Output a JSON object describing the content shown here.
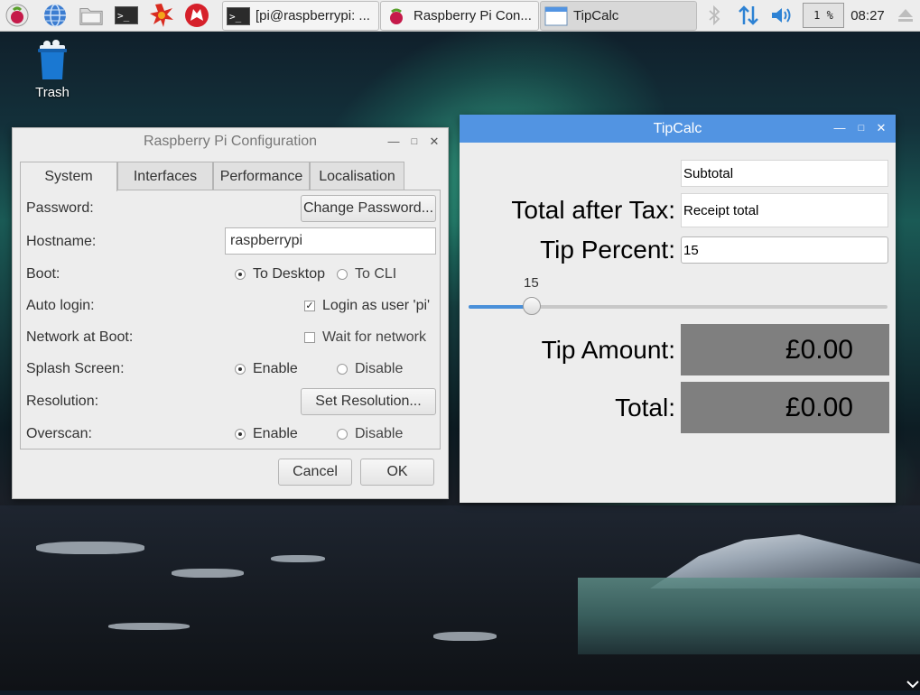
{
  "taskbar": {
    "tasks": [
      {
        "label": "[pi@raspberrypi: ..."
      },
      {
        "label": "Raspberry Pi Con..."
      },
      {
        "label": "TipCalc"
      }
    ],
    "cpu": "1 %",
    "clock": "08:27"
  },
  "desktop": {
    "trash_label": "Trash"
  },
  "raspi_config": {
    "title": "Raspberry Pi Configuration",
    "tabs": [
      "System",
      "Interfaces",
      "Performance",
      "Localisation"
    ],
    "password_label": "Password:",
    "change_password": "Change Password...",
    "hostname_label": "Hostname:",
    "hostname_value": "raspberrypi",
    "boot_label": "Boot:",
    "boot_desktop": "To Desktop",
    "boot_cli": "To CLI",
    "autologin_label": "Auto login:",
    "autologin_option": "Login as user 'pi'",
    "network_label": "Network at Boot:",
    "network_option": "Wait for network",
    "splash_label": "Splash Screen:",
    "splash_enable": "Enable",
    "splash_disable": "Disable",
    "resolution_label": "Resolution:",
    "set_resolution": "Set Resolution...",
    "overscan_label": "Overscan:",
    "overscan_enable": "Enable",
    "overscan_disable": "Disable",
    "cancel": "Cancel",
    "ok": "OK"
  },
  "tipcalc": {
    "title": "TipCalc",
    "subtotal_placeholder": "Subtotal",
    "total_after_tax_label": "Total after Tax:",
    "receipt_placeholder": "Receipt total",
    "tip_percent_label": "Tip Percent:",
    "tip_percent_value": "15",
    "slider_value": "15",
    "slider_fraction": 0.15,
    "tip_amount_label": "Tip Amount:",
    "tip_amount_value": "£0.00",
    "total_label": "Total:",
    "total_value": "£0.00"
  },
  "colors": {
    "accent": "#5294e2",
    "output_bg": "#7f7f7f"
  }
}
